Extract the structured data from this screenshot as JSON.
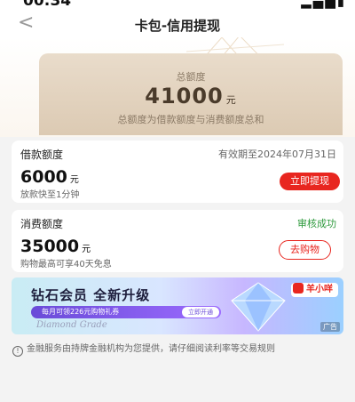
{
  "status_bar": {
    "time": "00:34",
    "signal_icon": "signal-icon",
    "battery_icon": "battery-icon"
  },
  "nav": {
    "back_icon": "chevron-left-icon",
    "title": "卡包-信用提现"
  },
  "total": {
    "label": "总额度",
    "amount": "41000",
    "unit": "元",
    "desc": "总额度为借款额度与消费额度总和"
  },
  "loan": {
    "title": "借款额度",
    "validity": "有效期至2024年07月31日",
    "amount": "6000",
    "unit": "元",
    "sub": "放款快至1分钟",
    "button": "立即提现"
  },
  "consume": {
    "title": "消费额度",
    "status": "审核成功",
    "amount": "35000",
    "unit": "元",
    "sub": "购物最高可享40天免息",
    "button": "去购物"
  },
  "banner": {
    "title": "钻石会员  全新升级",
    "pill_text": "每月可领226元购物礼券",
    "pill_button": "立即开通",
    "script_text": "Diamond Grade",
    "brand": "羊小咩",
    "ad_tag": "广告"
  },
  "footer": {
    "note": "金融服务由持牌金融机构为您提供，请仔细阅读利率等交易规则"
  },
  "colors": {
    "accent": "#e8261f",
    "gold": "#dccab3",
    "success": "#2e9a3d"
  }
}
